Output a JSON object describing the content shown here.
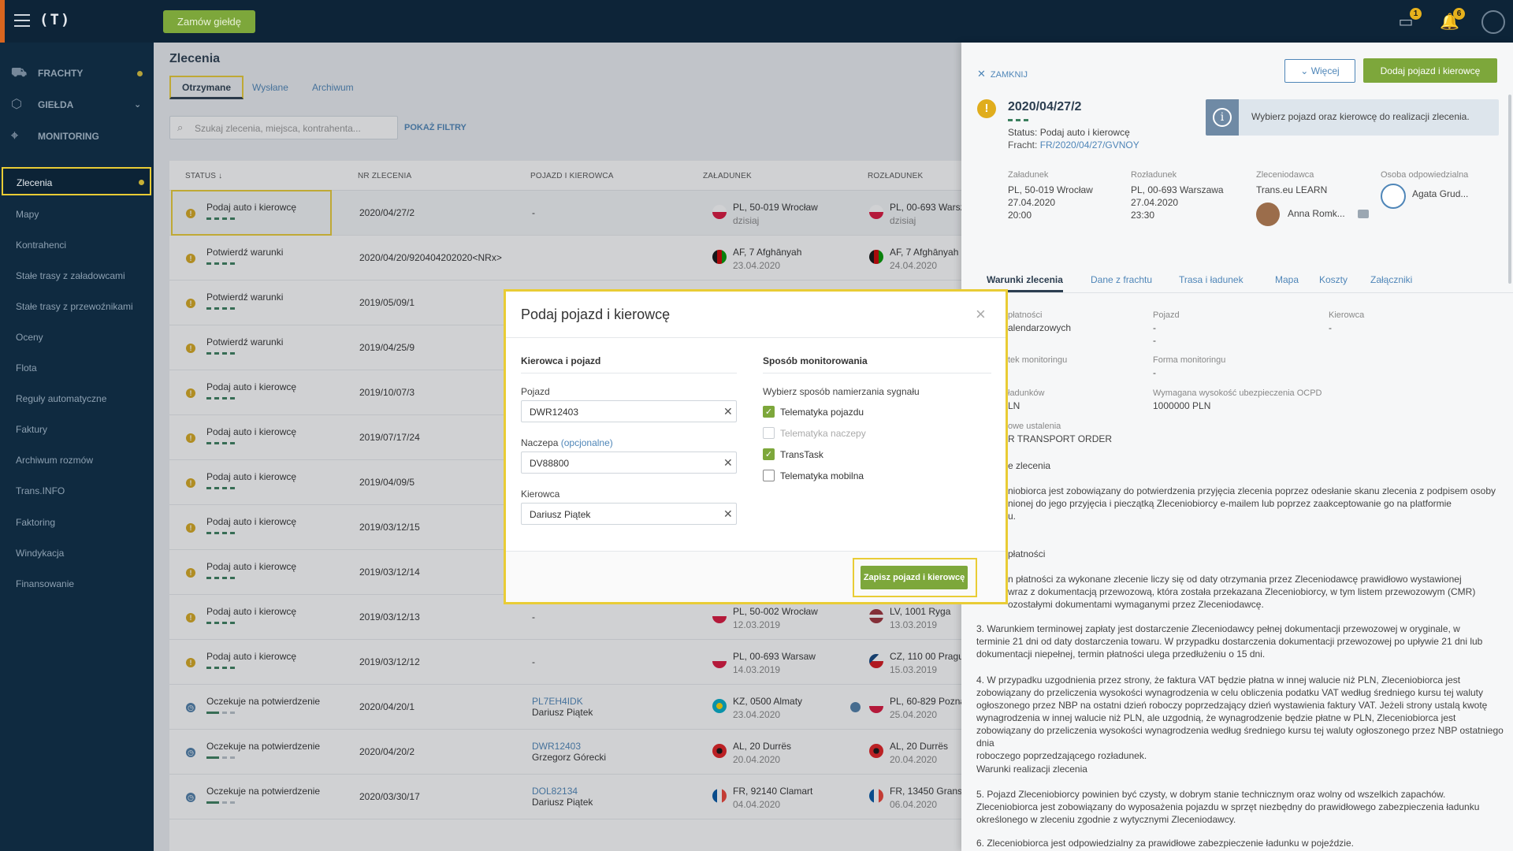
{
  "topbar": {
    "logo": "(T)",
    "exchange_button": "Zamów giełdę",
    "messages_badge": "1",
    "notifications_badge": "6"
  },
  "sidebar": {
    "top": [
      {
        "label": "FRACHTY",
        "icon": "freight-icon"
      },
      {
        "label": "GIEŁDA",
        "icon": "exchange-box-icon"
      },
      {
        "label": "MONITORING",
        "icon": "monitoring-icon"
      }
    ],
    "sub": [
      "Zlecenia",
      "Mapy",
      "Kontrahenci",
      "Stałe trasy z załadowcami",
      "Stałe trasy z przewoźnikami",
      "Oceny",
      "Flota",
      "Reguły automatyczne",
      "Faktury",
      "Archiwum rozmów",
      "Trans.INFO",
      "Faktoring",
      "Windykacja",
      "Finansowanie"
    ]
  },
  "main": {
    "title": "Zlecenia",
    "tabs": [
      "Otrzymane",
      "Wysłane",
      "Archiwum"
    ],
    "search_placeholder": "Szukaj zlecenia, miejsca, kontrahenta...",
    "show_filters": "POKAŻ FILTRY",
    "headers": [
      "STATUS ↓",
      "NR ZLECENIA",
      "POJAZD I KIEROWCA",
      "ZAŁADUNEK",
      "ROZŁADUNEK"
    ],
    "rows": [
      {
        "status": "Podaj auto i kierowcę",
        "nr": "2020/04/27/2",
        "veh": "-",
        "veh2": "",
        "load": "PL, 50-019 Wrocław",
        "load_d": "dzisiaj",
        "unload": "PL, 00-693 Warsz",
        "unload_d": "dzisiaj"
      },
      {
        "status": "Potwierdź warunki",
        "nr": "2020/04/20/920404202020<NRx>",
        "veh": "",
        "veh2": "",
        "load": "AF, 7 Afghānyah",
        "load_d": "23.04.2020",
        "unload": "AF, 7 Afghānyah",
        "unload_d": "24.04.2020"
      },
      {
        "status": "Potwierdź warunki",
        "nr": "2019/05/09/1",
        "veh": "",
        "veh2": "",
        "load": "",
        "load_d": "",
        "unload": "",
        "unload_d": ""
      },
      {
        "status": "Potwierdź warunki",
        "nr": "2019/04/25/9",
        "veh": "",
        "veh2": "",
        "load": "",
        "load_d": "",
        "unload": "",
        "unload_d": ""
      },
      {
        "status": "Podaj auto i kierowcę",
        "nr": "2019/10/07/3",
        "veh": "",
        "veh2": "",
        "load": "",
        "load_d": "",
        "unload": "",
        "unload_d": ""
      },
      {
        "status": "Podaj auto i kierowcę",
        "nr": "2019/07/17/24",
        "veh": "",
        "veh2": "",
        "load": "",
        "load_d": "",
        "unload": "",
        "unload_d": ""
      },
      {
        "status": "Podaj auto i kierowcę",
        "nr": "2019/04/09/5",
        "veh": "",
        "veh2": "",
        "load": "",
        "load_d": "",
        "unload": "",
        "unload_d": ""
      },
      {
        "status": "Podaj auto i kierowcę",
        "nr": "2019/03/12/15",
        "veh": "",
        "veh2": "",
        "load": "",
        "load_d": "",
        "unload": "",
        "unload_d": ""
      },
      {
        "status": "Podaj auto i kierowcę",
        "nr": "2019/03/12/14",
        "veh": "",
        "veh2": "",
        "load": "",
        "load_d": "",
        "unload": "",
        "unload_d": ""
      },
      {
        "status": "Podaj auto i kierowcę",
        "nr": "2019/03/12/13",
        "veh": "-",
        "veh2": "",
        "load": "PL, 50-002 Wrocław",
        "load_d": "12.03.2019",
        "unload": "LV, 1001 Ryga",
        "unload_d": "13.03.2019"
      },
      {
        "status": "Podaj auto i kierowcę",
        "nr": "2019/03/12/12",
        "veh": "-",
        "veh2": "",
        "load": "PL, 00-693 Warsaw",
        "load_d": "14.03.2019",
        "unload": "CZ, 110 00 Pragu",
        "unload_d": "15.03.2019"
      },
      {
        "status": "Oczekuje na potwierdzenie",
        "nr": "2020/04/20/1",
        "veh": "PL7EH4IDK",
        "veh2": "Dariusz Piątek",
        "load": "KZ, 0500 Almaty",
        "load_d": "23.04.2020",
        "unload": "PL, 60-829 Pozna",
        "unload_d": "25.04.2020"
      },
      {
        "status": "Oczekuje na potwierdzenie",
        "nr": "2020/04/20/2",
        "veh": "DWR12403",
        "veh2": "Grzegorz Górecki",
        "load": "AL, 20 Durrës",
        "load_d": "20.04.2020",
        "unload": "AL, 20 Durrës",
        "unload_d": "20.04.2020"
      },
      {
        "status": "Oczekuje na potwierdzenie",
        "nr": "2020/03/30/17",
        "veh": "DOL82134",
        "veh2": "Dariusz Piątek",
        "load": "FR, 92140 Clamart",
        "load_d": "04.04.2020",
        "unload": "FR, 13450 Grans",
        "unload_d": "06.04.2020"
      }
    ]
  },
  "panel": {
    "close": "ZAMKNIJ",
    "more": "Więcej",
    "add_vehicle": "Dodaj pojazd i kierowcę",
    "nr": "2020/04/27/2",
    "status": "Status: Podaj auto i kierowcę",
    "fracht_label": "Fracht:",
    "fracht_link": "FR/2020/04/27/GVNOY",
    "info": "Wybierz pojazd oraz kierowcę do realizacji zlecenia.",
    "load_h": "Załadunek",
    "load": [
      "PL, 50-019 Wrocław",
      "27.04.2020",
      "20:00"
    ],
    "unload_h": "Rozładunek",
    "unload": [
      "PL, 00-693 Warszawa",
      "27.04.2020",
      "23:30"
    ],
    "client_h": "Zleceniodawca",
    "client": "Trans.eu LEARN",
    "client_person": "Anna Romk...",
    "resp_h": "Osoba odpowiedzialna",
    "resp": "Agata Grud...",
    "tabs": [
      "Warunki zlecenia",
      "Dane z frachtu",
      "Trasa i ładunek",
      "Mapa",
      "Koszty",
      "Załączniki"
    ],
    "f_pay_h": "płatności",
    "f_pay": "alendarzowych",
    "f_veh_h": "Pojazd",
    "f_veh1": "-",
    "f_veh2": "-",
    "f_drv_h": "Kierowca",
    "f_drv": "-",
    "f_mon_h": "tek monitoringu",
    "f_monf_h": "Forma monitoringu",
    "f_monf": "-",
    "f_cargo_h": "ładunków",
    "f_cargo": "LN",
    "f_ins_h": "Wymagana wysokość ubezpieczenia OCPD",
    "f_ins": "1000000 PLN",
    "f_other_h": "owe ustalenia",
    "f_other": "R TRANSPORT ORDER",
    "sec1": "e zlecenia",
    "para1": "niobiorca jest zobowiązany do potwierdzenia przyjęcia zlecenia poprzez odesłanie skanu zlecenia z podpisem osoby\nnionej do jego przyjęcia i pieczątką Zleceniobiorcy e-mailem lub poprzez zaakceptowanie go na platformie\nu.",
    "sec2": "płatności",
    "para2": "n płatności za wykonane zlecenie liczy się od daty otrzymania przez Zleceniodawcę prawidłowo wystawionej\nwraz z dokumentacją przewozową, która została przekazana Zleceniobiorcy, w tym listem przewozowym (CMR)\nozostałymi dokumentami wymaganymi przez Zleceniodawcę.",
    "para3": "3. Warunkiem terminowej zapłaty jest dostarczenie Zleceniodawcy pełnej dokumentacji przewozowej w oryginale, w\nterminie 21 dni od daty dostarczenia towaru. W przypadku dostarczenia dokumentacji przewozowej po upływie 21 dni lub\ndokumentacji niepełnej, termin płatności ulega przedłużeniu o 15 dni.",
    "para4": "4. W przypadku uzgodnienia przez strony, że faktura VAT będzie płatna w innej walucie niż PLN, Zleceniobiorca jest\nzobowiązany do przeliczenia wysokości wynagrodzenia w celu obliczenia podatku VAT według średniego kursu tej waluty\nogłoszonego przez NBP na ostatni dzień roboczy poprzedzający dzień wystawienia faktury VAT. Jeżeli strony ustalą kwotę\nwynagrodzenia w innej walucie niż PLN, ale uzgodnią, że wynagrodzenie będzie płatne w PLN, Zleceniobiorca jest\nzobowiązany do przeliczenia wysokości wynagrodzenia według średniego kursu tej waluty ogłoszonego przez NBP ostatniego dnia\nroboczego poprzedzającego rozładunek.",
    "sec3": "Warunki realizacji zlecenia",
    "para5": "5. Pojazd Zleceniobiorcy powinien być czysty, w dobrym stanie technicznym    oraz wolny od wszelkich zapachów.\nZleceniobiorca jest zobowiązany do wyposażenia pojazdu w sprzęt niezbędny do prawidłowego zabezpieczenia ładunku\nokreślonego w zleceniu zgodnie z wytycznymi Zleceniodawcy.",
    "para6": "6. Zleceniobiorca jest odpowiedzialny za prawidłowe zabezpieczenie ładunku w pojeździe."
  },
  "modal": {
    "title": "Podaj pojazd i kierowcę",
    "left_header": "Kierowca i pojazd",
    "vehicle_label": "Pojazd",
    "vehicle_value": "DWR12403",
    "trailer_label": "Naczepa",
    "trailer_optional": "(opcjonalne)",
    "trailer_value": "DV88800",
    "driver_label": "Kierowca",
    "driver_value": "Dariusz Piątek",
    "right_header": "Sposób monitorowania",
    "right_sub": "Wybierz sposób namierzania sygnału",
    "options": [
      {
        "label": "Telematyka pojazdu",
        "checked": true,
        "disabled": false
      },
      {
        "label": "Telematyka naczepy",
        "checked": false,
        "disabled": true
      },
      {
        "label": "TransTask",
        "checked": true,
        "disabled": false
      },
      {
        "label": "Telematyka mobilna",
        "checked": false,
        "disabled": false
      }
    ],
    "save": "Zapisz pojazd i kierowcę"
  },
  "colors": {
    "accent": "#7da73b",
    "highlight": "#e9cc35",
    "navy": "#0d2438",
    "link": "#4f86b8"
  }
}
